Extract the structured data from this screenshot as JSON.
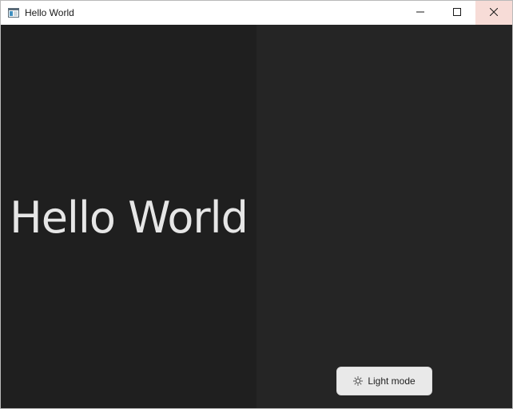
{
  "window": {
    "title": "Hello World",
    "app_icon": "window-app-icon",
    "controls": {
      "minimize_icon": "minimize-icon",
      "maximize_icon": "maximize-icon",
      "close_icon": "close-icon"
    }
  },
  "main": {
    "heading": "Hello World",
    "theme_toggle": {
      "label": "Light mode",
      "icon": "sun-icon"
    }
  },
  "colors": {
    "left_pane": "#1f1f1f",
    "right_pane": "#252525",
    "close_hover": "#f7dcd7",
    "button_bg": "#e9e9e9"
  }
}
